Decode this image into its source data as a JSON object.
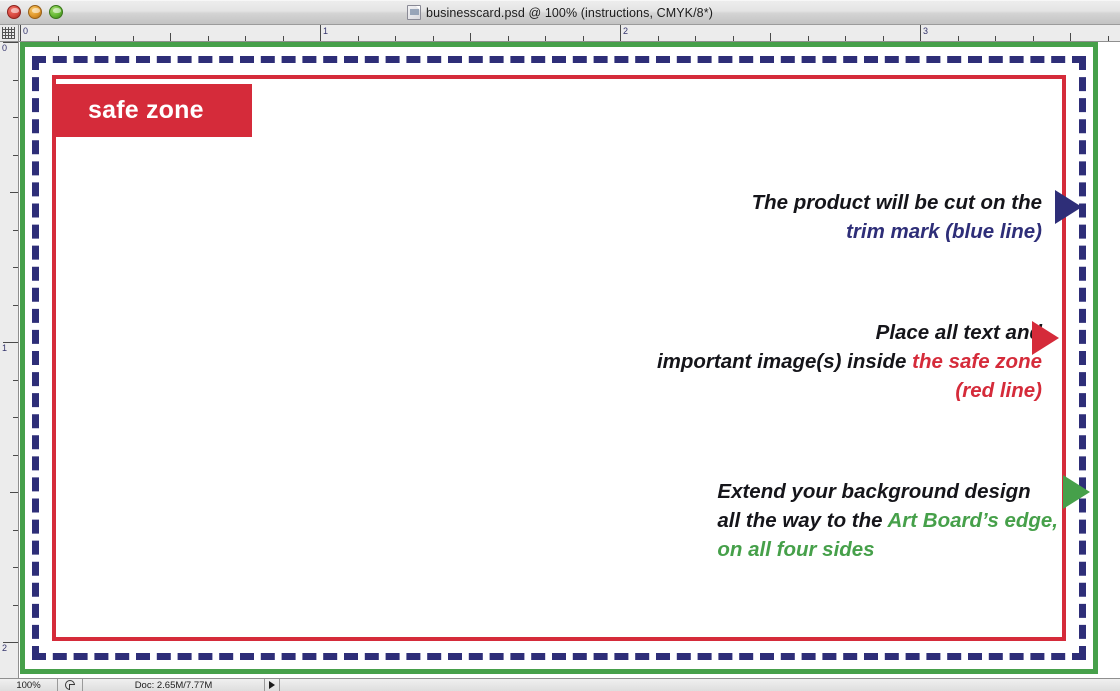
{
  "window": {
    "title": "businesscard.psd @ 100% (instructions, CMYK/8*)",
    "doc_icon": "photoshop-document-icon",
    "controls": {
      "close": "close-button",
      "minimize": "minimize-button",
      "zoom": "zoom-button"
    }
  },
  "rulers": {
    "unit_label": "inches",
    "horizontal_labels": [
      "0",
      "1",
      "2",
      "3"
    ],
    "vertical_labels": [
      "0",
      "1",
      "2"
    ],
    "pixels_per_unit": 300
  },
  "canvas": {
    "badge": {
      "label": "safe zone",
      "background": "#d52b3a",
      "text_color": "#ffffff"
    },
    "guides": {
      "artboard_edge_color": "#46a04a",
      "trim_mark_color": "#2e2e78",
      "safe_zone_color": "#d52b3a"
    },
    "annotations": [
      {
        "id": "trim-mark-note",
        "arrow_color": "#2e2e78",
        "lines": [
          [
            {
              "text": "The product will be cut on the",
              "color": "black"
            }
          ],
          [
            {
              "text": "trim mark (blue line)",
              "color": "blue"
            }
          ]
        ]
      },
      {
        "id": "safe-zone-note",
        "arrow_color": "#d52b3a",
        "lines": [
          [
            {
              "text": "Place all text and",
              "color": "black"
            }
          ],
          [
            {
              "text": "important image(s) inside ",
              "color": "black"
            },
            {
              "text": "the safe zone",
              "color": "red"
            }
          ],
          [
            {
              "text": "(red line)",
              "color": "red"
            }
          ]
        ]
      },
      {
        "id": "bleed-note",
        "arrow_color": "#46a04a",
        "lines": [
          [
            {
              "text": "Extend your background design",
              "color": "black"
            }
          ],
          [
            {
              "text": "all the way to the ",
              "color": "black"
            },
            {
              "text": "Art Board’s edge,",
              "color": "green"
            }
          ],
          [
            {
              "text": "on all four sides",
              "color": "green"
            }
          ]
        ]
      }
    ]
  },
  "statusbar": {
    "zoom_level": "100%",
    "doc_info": "Doc: 2.65M/7.77M",
    "info_icon": "document-info-icon",
    "expand_arrow": "right-triangle-icon"
  }
}
